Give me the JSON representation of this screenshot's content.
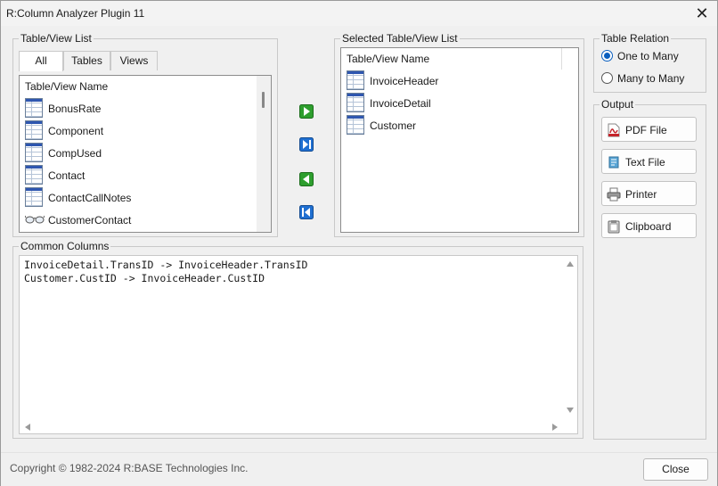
{
  "window": {
    "title": "R:Column Analyzer Plugin 11"
  },
  "table_view_list": {
    "label": "Table/View List",
    "tabs": [
      "All",
      "Tables",
      "Views"
    ],
    "active_tab": "All",
    "header": "Table/View Name",
    "items": [
      {
        "name": "BonusRate",
        "icon": "table-icon"
      },
      {
        "name": "Component",
        "icon": "table-icon"
      },
      {
        "name": "CompUsed",
        "icon": "table-icon"
      },
      {
        "name": "Contact",
        "icon": "table-icon"
      },
      {
        "name": "ContactCallNotes",
        "icon": "table-icon"
      },
      {
        "name": "CustomerContact",
        "icon": "view-glasses-icon"
      }
    ]
  },
  "move_buttons": [
    "add-selected-icon",
    "add-all-icon",
    "remove-selected-icon",
    "remove-all-icon"
  ],
  "selected_list": {
    "label": "Selected Table/View List",
    "header": "Table/View Name",
    "items": [
      "InvoiceHeader",
      "InvoiceDetail",
      "Customer"
    ]
  },
  "table_relation": {
    "label": "Table Relation",
    "options": [
      "One to Many",
      "Many to Many"
    ],
    "selected": "One to Many"
  },
  "output": {
    "label": "Output",
    "buttons": [
      {
        "label": "PDF File",
        "icon": "pdf-icon"
      },
      {
        "label": "Text File",
        "icon": "text-file-icon"
      },
      {
        "label": "Printer",
        "icon": "printer-icon"
      },
      {
        "label": "Clipboard",
        "icon": "clipboard-icon"
      }
    ]
  },
  "common_columns": {
    "label": "Common Columns",
    "lines": [
      "InvoiceDetail.TransID -> InvoiceHeader.TransID",
      "Customer.CustID -> InvoiceHeader.CustID"
    ]
  },
  "footer": {
    "copyright": "Copyright © 1982-2024 R:BASE Technologies Inc.",
    "close_label": "Close"
  },
  "colors": {
    "accent": "#0a5fbf",
    "move_green": "#2e9e2e",
    "move_blue": "#1f6fd1"
  }
}
